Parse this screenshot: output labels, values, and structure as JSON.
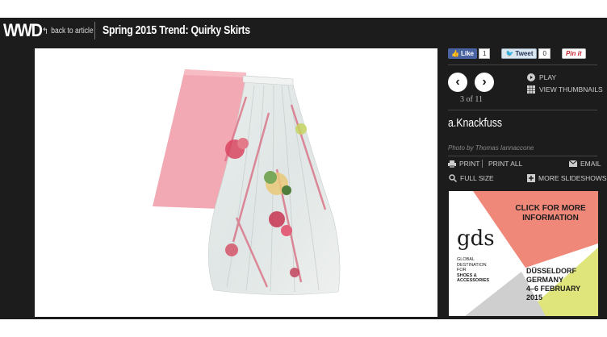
{
  "header": {
    "logo": "WWD",
    "back_label": "back to article",
    "title": "Spring 2015 Trend: Quirky Skirts"
  },
  "social": {
    "like_label": "Like",
    "like_count": "1",
    "tweet_label": "Tweet",
    "tweet_count": "0",
    "pin_label": "Pin it"
  },
  "slideshow": {
    "counter": "3 of 11",
    "play_label": "PLAY",
    "thumbnails_label": "VIEW THUMBNAILS"
  },
  "slide": {
    "designer": "a.Knackfuss",
    "credit": "Photo by Thomas Iannaccone"
  },
  "actions": {
    "print": "PRINT",
    "print_all": "PRINT ALL",
    "email": "EMAIL",
    "full_size": "FULL SIZE",
    "more_slideshows": "MORE SLIDESHOWS"
  },
  "ad": {
    "cta": "CLICK FOR MORE INFORMATION",
    "brand": "gds",
    "tagline_1": "GLOBAL",
    "tagline_2": "DESTINATION",
    "tagline_3": "FOR",
    "tagline_4": "SHOES &",
    "tagline_5": "ACCESSORIES",
    "city": "DÜSSELDORF",
    "country": "GERMANY",
    "dates": "4–6 FEBRUARY",
    "year": "2015"
  },
  "colors": {
    "background": "#1c1c1c",
    "ad_salmon": "#f0887a",
    "ad_lime": "#dfe57a",
    "skirt_pink": "#f3a9b4"
  }
}
